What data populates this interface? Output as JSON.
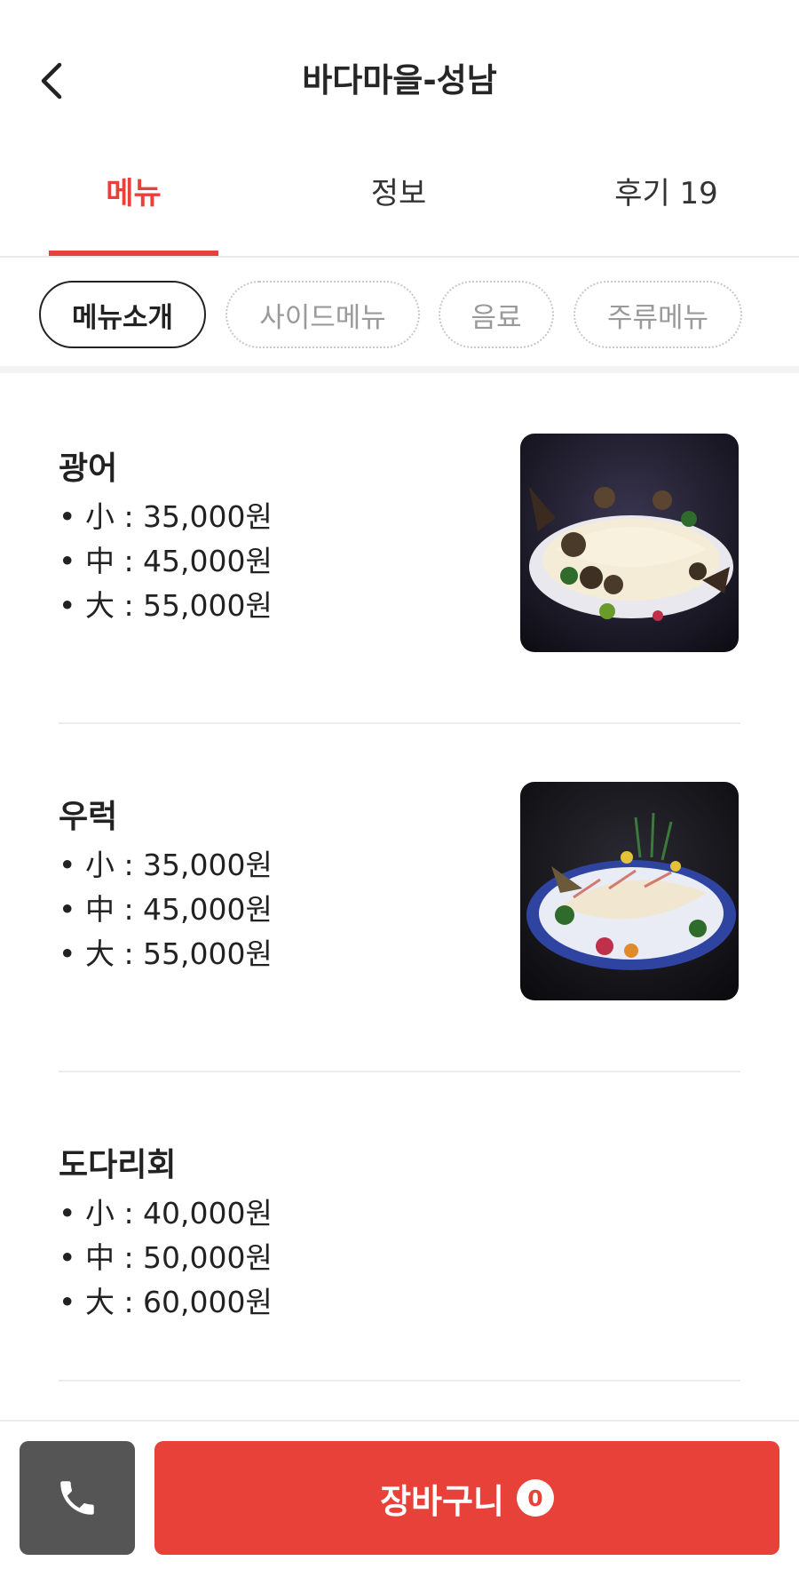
{
  "header": {
    "title": "바다마을-성남",
    "back_icon": "chevron-left-icon"
  },
  "tabs": [
    {
      "label": "메뉴",
      "active": true
    },
    {
      "label": "정보",
      "active": false
    },
    {
      "label": "후기 19",
      "active": false
    }
  ],
  "chips": [
    {
      "label": "메뉴소개",
      "active": true
    },
    {
      "label": "사이드메뉴",
      "active": false
    },
    {
      "label": "음료",
      "active": false
    },
    {
      "label": "주류메뉴",
      "active": false
    }
  ],
  "menu": [
    {
      "name": "광어",
      "prices": [
        "• 小 : 35,000원",
        "• 中 : 45,000원",
        "• 大 : 55,000원"
      ],
      "has_image": true
    },
    {
      "name": "우럭",
      "prices": [
        "• 小 : 35,000원",
        "• 中 : 45,000원",
        "• 大 : 55,000원"
      ],
      "has_image": true
    },
    {
      "name": "도다리회",
      "prices": [
        "• 小 : 40,000원",
        "• 中 : 50,000원",
        "• 大 : 60,000원"
      ],
      "has_image": false
    }
  ],
  "bottom": {
    "call_icon": "phone-icon",
    "cart_label": "장바구니",
    "cart_count": "0"
  },
  "colors": {
    "accent": "#e8413a",
    "call_button": "#555555"
  }
}
